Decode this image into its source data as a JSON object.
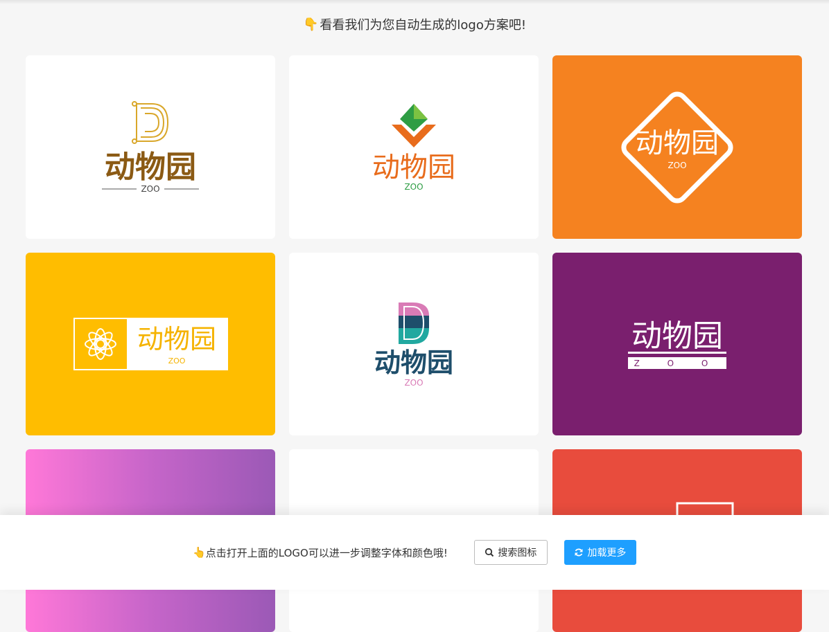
{
  "header": {
    "hand_icon": "pointing-down-hand-icon",
    "title": "看看我们为您自动生成的logo方案吧!"
  },
  "logos": [
    {
      "name": "动物园",
      "sub": "ZOO",
      "bg": "#ffffff",
      "text_color": "#8b5a14",
      "accent": "#d9a72a",
      "style": "gold-letter-d"
    },
    {
      "name": "动物园",
      "sub": "ZOO",
      "bg": "#ffffff",
      "text_color": "#e86c1c",
      "accent": "#2e9d44",
      "style": "green-arrow"
    },
    {
      "name": "动物园",
      "sub": "ZOO",
      "bg": "#f58220",
      "text_color": "#ffffff",
      "accent": "#ffffff",
      "style": "white-diamond"
    },
    {
      "name": "动物园",
      "sub": "ZOO",
      "bg": "#ffbd00",
      "text_color": "#f5b300",
      "accent": "#ffffff",
      "style": "flower-box"
    },
    {
      "name": "动物园",
      "sub": "ZOO",
      "bg": "#ffffff",
      "text_color": "#1e4e6b",
      "accent": "#d97bb6",
      "style": "color-letter-d"
    },
    {
      "name": "动物园",
      "sub": "Z O O",
      "bg": "#7a1f6e",
      "text_color": "#ffffff",
      "accent": "#ffffff",
      "style": "underline-bar"
    },
    {
      "bg": "#e070d8",
      "style": "gradient-partial"
    },
    {
      "bg": "#ffffff",
      "style": "blank-partial"
    },
    {
      "bg": "#e84c3d",
      "style": "frame-partial"
    }
  ],
  "footer": {
    "hand_icon": "pointing-up-hand-icon",
    "hint": "点击打开上面的LOGO可以进一步调整字体和颜色哦!",
    "search_label": "搜索图标",
    "search_icon": "search-icon",
    "more_label": "加载更多",
    "more_icon": "refresh-icon",
    "accent_color": "#1e9fff"
  }
}
